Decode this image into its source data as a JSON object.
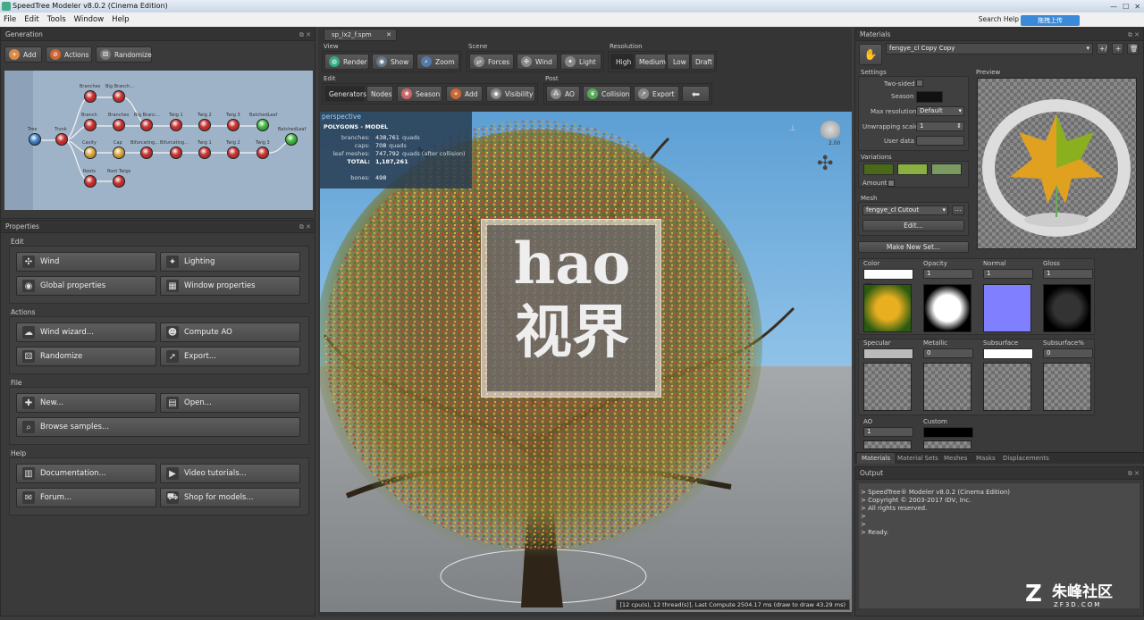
{
  "window": {
    "title": "SpeedTree Modeler v8.0.2 (Cinema Edition)"
  },
  "menu": [
    "File",
    "Edit",
    "Tools",
    "Window",
    "Help"
  ],
  "search_help": "Search Help",
  "upload_label": "拖拽上传",
  "generation": {
    "title": "Generation",
    "add": "Add",
    "actions": "Actions",
    "randomize": "Randomize",
    "nodes": {
      "trunk": "Trunk",
      "tree": "Tree",
      "branches": "Branches",
      "big_branch": "Big Branch...",
      "branch": "Branch",
      "caps": "Cavity",
      "cap": "Cap",
      "roots": "Roots",
      "root_twigs": "Root Twigs",
      "big_branch2": "Big Branc...",
      "bifurcating1": "Bifurcating...",
      "bifurcating2": "Bifurcating...",
      "twig1": "Twig 1",
      "twig2": "Twig 2",
      "twig3": "Twig 3",
      "twig1b": "Twig 1",
      "twig2b": "Twig 2",
      "twig3b": "Twig 3",
      "batched1": "BatchedLeaf",
      "batched2": "BatchedLeaf"
    }
  },
  "properties": {
    "title": "Properties",
    "edit": {
      "label": "Edit",
      "wind": "Wind",
      "lighting": "Lighting",
      "global": "Global properties",
      "window": "Window properties"
    },
    "actions": {
      "label": "Actions",
      "wind_wizard": "Wind wizard...",
      "compute_ao": "Compute AO",
      "randomize": "Randomize",
      "export": "Export..."
    },
    "file": {
      "label": "File",
      "new": "New...",
      "open": "Open...",
      "browse": "Browse samples..."
    },
    "help": {
      "label": "Help",
      "docs": "Documentation...",
      "videos": "Video tutorials...",
      "forum": "Forum...",
      "shop": "Shop for models..."
    }
  },
  "document_tab": "sp_lx2_f.spm",
  "toolbar": {
    "view": "View",
    "render": "Render",
    "show": "Show",
    "zoom": "Zoom",
    "scene": "Scene",
    "forces": "Forces",
    "wind": "Wind",
    "light": "Light",
    "resolution": "Resolution",
    "high": "High",
    "medium": "Medium",
    "low": "Low",
    "draft": "Draft",
    "edit": "Edit",
    "generators": "Generators",
    "nodes": "Nodes",
    "season": "Season",
    "add": "Add",
    "visibility": "Visibility",
    "post": "Post",
    "ao": "AO",
    "collision": "Collision",
    "export": "Export"
  },
  "viewport": {
    "label": "perspective",
    "stats_title": "POLYGONS - MODEL",
    "stats": [
      {
        "k": "branches:",
        "v": "438,761",
        "u": "quads"
      },
      {
        "k": "caps:",
        "v": "708",
        "u": "quads"
      },
      {
        "k": "leaf meshes:",
        "v": "747,792",
        "u": "quads (after collision)"
      },
      {
        "k": "TOTAL:",
        "v": "1,187,261",
        "u": ""
      },
      {
        "k": "bones:",
        "v": "498",
        "u": ""
      }
    ],
    "wind_value": "2.00",
    "status": "[12 cpu(s), 12 thread(s)], Last Compute 2504.17 ms (draw to draw 43.29 ms)",
    "watermark_top": "hao",
    "watermark_bottom": "视界"
  },
  "materials": {
    "title": "Materials",
    "material_name": "fengye_cl Copy Copy",
    "settings": "Settings",
    "two_sided": "Two-sided",
    "season": "Season",
    "max_res": "Max resolution",
    "max_res_val": "Default",
    "unwrap": "Unwrapping scale",
    "unwrap_val": "1",
    "user_data": "User data",
    "variations": "Variations",
    "amount": "Amount",
    "mesh": "Mesh",
    "mesh_val": "fengye_cl Cutout",
    "edit": "Edit...",
    "make_new_set": "Make New Set...",
    "preview": "Preview",
    "slots": {
      "color": "Color",
      "opacity": "Opacity",
      "normal": "Normal",
      "gloss": "Gloss",
      "specular": "Specular",
      "metallic": "Metallic",
      "subsurface": "Subsurface",
      "subsurface_pct": "Subsurface%",
      "ao": "AO",
      "custom": "Custom"
    },
    "slot_values": {
      "opacity": "1",
      "normal": "1",
      "gloss": "1",
      "metallic": "0",
      "subsurface_pct": "0",
      "ao": "1"
    },
    "tabs": [
      "Materials",
      "Material Sets",
      "Meshes",
      "Masks",
      "Displacements"
    ]
  },
  "output": {
    "title": "Output",
    "lines": [
      "> SpeedTree® Modeler v8.0.2 (Cinema Edition)",
      "> Copyright © 2003-2017 IDV, Inc.",
      "> All rights reserved.",
      ">",
      ">",
      "> Ready."
    ]
  },
  "corner_logo": {
    "text": "朱峰社区",
    "sub": "ZF3D.COM"
  },
  "colors": {
    "accent": "#3b8ad9",
    "bg": "#3c3c3c",
    "sky": "#6aa9d8"
  }
}
